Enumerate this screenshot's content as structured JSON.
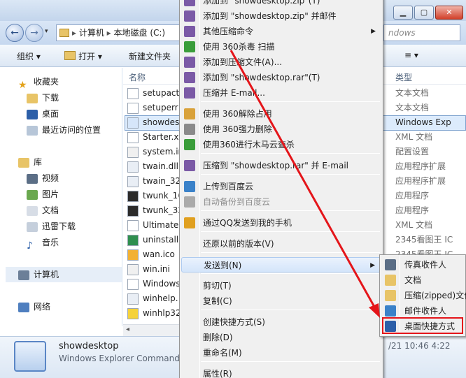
{
  "window": {
    "search_placeholder": "ndows",
    "breadcrumb": [
      "计算机",
      "本地磁盘 (C:)"
    ]
  },
  "toolbar": {
    "organize": "组织 ▾",
    "open": "打开 ▾",
    "new_folder": "新建文件夹",
    "views": "≡ ▾"
  },
  "navpane": {
    "favorites": "收藏夹",
    "downloads": "下载",
    "desktop": "桌面",
    "recent": "最近访问的位置",
    "libraries": "库",
    "videos": "视频",
    "pictures": "图片",
    "documents": "文档",
    "thunder": "迅雷下载",
    "music": "音乐",
    "computer": "计算机",
    "network": "网络"
  },
  "columns": {
    "name": "名称",
    "type": "类型"
  },
  "files": [
    {
      "name": "setupact",
      "type": "文本文档"
    },
    {
      "name": "setuperr",
      "type": "文本文档"
    },
    {
      "name": "showdes",
      "type": "Windows Exp"
    },
    {
      "name": "Starter.x",
      "type": "XML 文档"
    },
    {
      "name": "system.in",
      "type": "配置设置"
    },
    {
      "name": "twain.dll",
      "type": "应用程序扩展"
    },
    {
      "name": "twain_32",
      "type": "应用程序扩展"
    },
    {
      "name": "twunk_16",
      "type": "应用程序"
    },
    {
      "name": "twunk_32",
      "type": "应用程序"
    },
    {
      "name": "Ultimate",
      "type": "XML 文档"
    },
    {
      "name": "uninstall.",
      "type": "2345看图王 IC"
    },
    {
      "name": "wan.ico",
      "type": "2345看图王 IC"
    },
    {
      "name": "win.ini",
      "type": ""
    },
    {
      "name": "Windows",
      "type": ""
    },
    {
      "name": "winhelp.",
      "type": ""
    },
    {
      "name": "winhlp32",
      "type": ""
    }
  ],
  "details": {
    "name": "showdesktop",
    "desc": "Windows Explorer Command",
    "date": "/21 10:46 4:22"
  },
  "context_menu": {
    "items": [
      {
        "label": "添加到 \"showdesktop.zip\"(T)",
        "disabled": false
      },
      {
        "label": "添加到 \"showdesktop.zip\" 并邮件",
        "disabled": false
      },
      {
        "label": "其他压缩命令",
        "disabled": false,
        "submenu": true
      },
      {
        "label": "使用 360杀毒 扫描",
        "disabled": false
      },
      {
        "label": "添加到压缩文件(A)...",
        "disabled": false
      },
      {
        "label": "添加到 \"showdesktop.rar\"(T)",
        "disabled": false
      },
      {
        "label": "压缩并 E-mail...",
        "disabled": false
      },
      {
        "label": "使用 360解除占用",
        "disabled": false
      },
      {
        "label": "使用 360强力删除",
        "disabled": false
      },
      {
        "label": "使用360进行木马云查杀",
        "disabled": false
      },
      {
        "label": "压缩到 \"showdesktop.rar\" 并 E-mail",
        "disabled": false
      },
      {
        "label": "上传到百度云",
        "disabled": false
      },
      {
        "label": "自动备份到百度云",
        "disabled": true
      },
      {
        "label": "通过QQ发送到我的手机",
        "disabled": false
      },
      {
        "label": "还原以前的版本(V)",
        "disabled": false
      },
      {
        "label": "发送到(N)",
        "disabled": false,
        "submenu": true,
        "highlighted": true
      },
      {
        "label": "剪切(T)",
        "disabled": false
      },
      {
        "label": "复制(C)",
        "disabled": false
      },
      {
        "label": "创建快捷方式(S)",
        "disabled": false
      },
      {
        "label": "删除(D)",
        "disabled": false
      },
      {
        "label": "重命名(M)",
        "disabled": false
      },
      {
        "label": "属性(R)",
        "disabled": false
      }
    ]
  },
  "sendto_menu": {
    "items": [
      {
        "label": "传真收件人"
      },
      {
        "label": "文档"
      },
      {
        "label": "压缩(zipped)文件"
      },
      {
        "label": "邮件收件人"
      },
      {
        "label": "桌面快捷方式"
      }
    ]
  },
  "colors": {
    "highlight_box": "#e4151a",
    "arrow": "#e4151a"
  }
}
